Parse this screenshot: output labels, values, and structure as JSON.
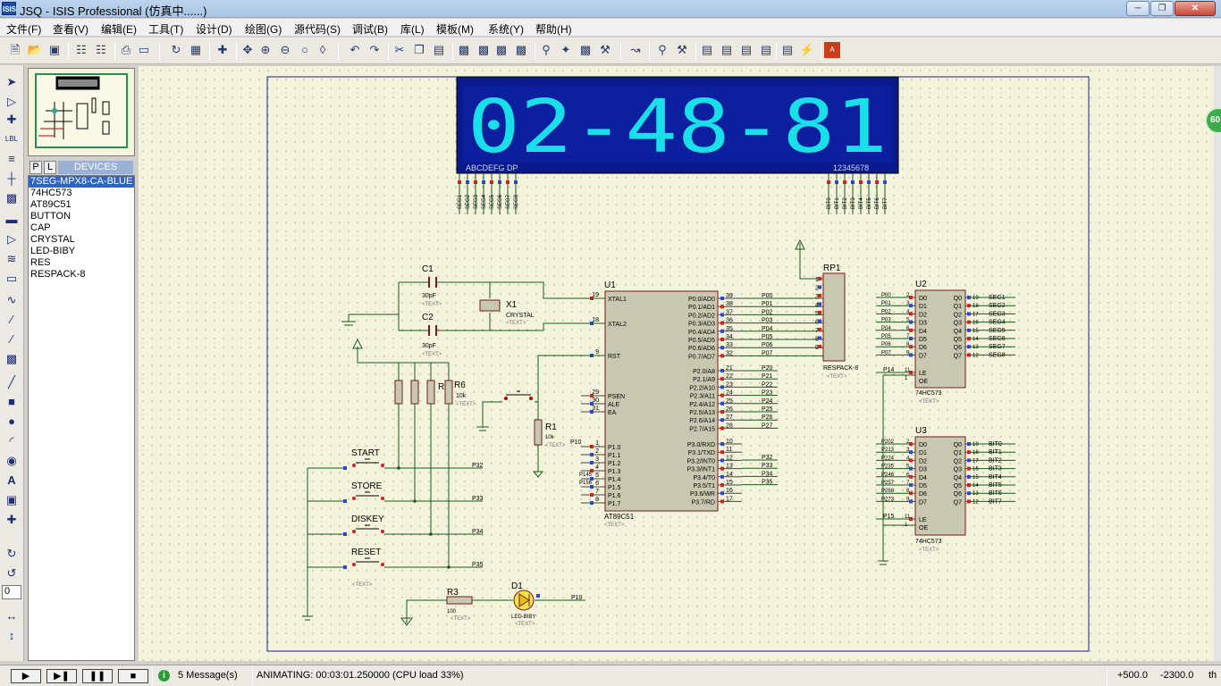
{
  "window": {
    "title": "JSQ - ISIS Professional (仿真中......)",
    "icon_label": "ISIS"
  },
  "menu": [
    "文件(F)",
    "查看(V)",
    "编辑(E)",
    "工具(T)",
    "设计(D)",
    "绘图(G)",
    "源代码(S)",
    "调试(B)",
    "库(L)",
    "模板(M)",
    "系统(Y)",
    "帮助(H)"
  ],
  "devices": {
    "tabs": [
      "P",
      "L"
    ],
    "title": "DEVICES",
    "items": [
      "7SEG-MPX8-CA-BLUE",
      "74HC573",
      "AT89C51",
      "BUTTON",
      "CAP",
      "CRYSTAL",
      "LED-BIBY",
      "RES",
      "RESPACK-8"
    ],
    "selected": 0
  },
  "rotation": "0",
  "display": {
    "digits": "02-48-81",
    "seg_label": "ABCDEFG DP",
    "com_label": "12345678",
    "color_bg": "#0a1a8a",
    "color_seg": "#19e0e8",
    "seg_pins": [
      "SEG1",
      "SEG2",
      "SEG3",
      "SEG4",
      "SEG5",
      "SEG6",
      "SEG7",
      "SEG8"
    ],
    "bit_pins": [
      "BIT0",
      "BIT1",
      "BIT2",
      "BIT3",
      "BIT4",
      "BIT5",
      "BIT6",
      "BIT7"
    ]
  },
  "u1": {
    "ref": "U1",
    "name": "AT89C51",
    "text": "<TEXT>",
    "left_pins": [
      [
        "19",
        "XTAL1"
      ],
      [
        "18",
        "XTAL2"
      ],
      [
        "9",
        "RST"
      ],
      [
        "29",
        "PSEN"
      ],
      [
        "30",
        "ALE"
      ],
      [
        "31",
        "EA"
      ],
      [
        "1",
        "P1.0"
      ],
      [
        "2",
        "P1.1"
      ],
      [
        "3",
        "P1.2"
      ],
      [
        "4",
        "P1.3"
      ],
      [
        "5",
        "P1.4"
      ],
      [
        "6",
        "P1.5"
      ],
      [
        "7",
        "P1.6"
      ],
      [
        "8",
        "P1.7"
      ]
    ],
    "p0_pins": [
      [
        "39",
        "P0.0/AD0"
      ],
      [
        "38",
        "P0.1/AD1"
      ],
      [
        "37",
        "P0.2/AD2"
      ],
      [
        "36",
        "P0.3/AD3"
      ],
      [
        "35",
        "P0.4/AD4"
      ],
      [
        "34",
        "P0.5/AD5"
      ],
      [
        "33",
        "P0.6/AD6"
      ],
      [
        "32",
        "P0.7/AD7"
      ]
    ],
    "p2_pins": [
      [
        "21",
        "P2.0/A8"
      ],
      [
        "22",
        "P2.1/A9"
      ],
      [
        "23",
        "P2.2/A10"
      ],
      [
        "24",
        "P2.3/A11"
      ],
      [
        "25",
        "P2.4/A12"
      ],
      [
        "26",
        "P2.5/A13"
      ],
      [
        "27",
        "P2.6/A14"
      ],
      [
        "28",
        "P2.7/A15"
      ]
    ],
    "p3_pins": [
      [
        "10",
        "P3.0/RXD"
      ],
      [
        "11",
        "P3.1/TXD"
      ],
      [
        "12",
        "P3.2/INT0"
      ],
      [
        "13",
        "P3.3/INT1"
      ],
      [
        "14",
        "P3.4/T0"
      ],
      [
        "15",
        "P3.5/T1"
      ],
      [
        "16",
        "P3.6/WR"
      ],
      [
        "17",
        "P3.7/RD"
      ]
    ],
    "p0_nets": [
      "P00",
      "P01",
      "P02",
      "P03",
      "P04",
      "P05",
      "P06",
      "P07"
    ],
    "p2_nets": [
      "P20",
      "P21",
      "P22",
      "P23",
      "P24",
      "P25",
      "P26",
      "P27"
    ],
    "p3_nets": [
      "P32",
      "P33",
      "P34",
      "P35"
    ],
    "p1_nets": [
      "P10",
      "P145",
      "P156"
    ]
  },
  "rp1": {
    "ref": "RP1",
    "name": "RESPACK-8",
    "text": "<TEXT>",
    "pins": [
      "1",
      "2",
      "3",
      "4",
      "5",
      "6",
      "7",
      "8",
      "9"
    ]
  },
  "u2": {
    "ref": "U2",
    "name": "74HC573",
    "text": "<TEXT>",
    "d_pins": [
      [
        "2",
        "D0"
      ],
      [
        "3",
        "D1"
      ],
      [
        "4",
        "D2"
      ],
      [
        "5",
        "D3"
      ],
      [
        "6",
        "D4"
      ],
      [
        "7",
        "D5"
      ],
      [
        "8",
        "D6"
      ],
      [
        "9",
        "D7"
      ]
    ],
    "q_pins": [
      [
        "19",
        "Q0"
      ],
      [
        "18",
        "Q1"
      ],
      [
        "17",
        "Q2"
      ],
      [
        "16",
        "Q3"
      ],
      [
        "15",
        "Q4"
      ],
      [
        "14",
        "Q5"
      ],
      [
        "13",
        "Q6"
      ],
      [
        "12",
        "Q7"
      ]
    ],
    "in_nets": [
      "P00",
      "P01",
      "P02",
      "P03",
      "P04",
      "P05",
      "P06",
      "P07"
    ],
    "out_nets": [
      "SEG1",
      "SEG2",
      "SEG3",
      "SEG4",
      "SEG5",
      "SEG6",
      "SEG7",
      "SEG8"
    ],
    "le": [
      "11",
      "LE"
    ],
    "oe": [
      "1",
      "OE"
    ],
    "le_net": "P14"
  },
  "u3": {
    "ref": "U3",
    "name": "74HC573",
    "text": "<TEXT>",
    "in_nets": [
      "P202",
      "P213",
      "P224",
      "P235",
      "P246",
      "P257",
      "P268",
      "P273"
    ],
    "out_nets": [
      "BIT0",
      "BIT1",
      "BIT2",
      "BIT3",
      "BIT4",
      "BIT5",
      "BIT6",
      "BIT7"
    ],
    "le_net": "P15"
  },
  "c1": {
    "ref": "C1",
    "value": "30pF",
    "text": "<TEXT>"
  },
  "c2": {
    "ref": "C2",
    "value": "30pF",
    "text": "<TEXT>"
  },
  "x1": {
    "ref": "X1",
    "name": "CRYSTAL",
    "text": "<TEXT>"
  },
  "r6": {
    "ref": "R6",
    "value": "10k",
    "text": "<TEXT>"
  },
  "r_bank": {
    "ref": "R",
    "value": "10",
    "text": "<TEXT>"
  },
  "r1": {
    "ref": "R1",
    "value": "10k",
    "text": "<TEXT>"
  },
  "r3": {
    "ref": "R3",
    "value": "100",
    "text": "<TEXT>"
  },
  "d1": {
    "ref": "D1",
    "name": "LED-BIBY",
    "text": "<TEXT>",
    "net": "P10"
  },
  "buttons": [
    {
      "label": "START",
      "net": "P32"
    },
    {
      "label": "STORE",
      "net": "P33"
    },
    {
      "label": "DISKEY",
      "net": "P34"
    },
    {
      "label": "RESET",
      "net": "P35"
    }
  ],
  "reset_text": "<TEXT>",
  "status": {
    "messages": "5 Message(s)",
    "animating": "ANIMATING: 00:03:01.250000 (CPU load 33%)",
    "x": "+500.0",
    "y": "-2300.0",
    "unit": "th"
  },
  "fps": "60"
}
